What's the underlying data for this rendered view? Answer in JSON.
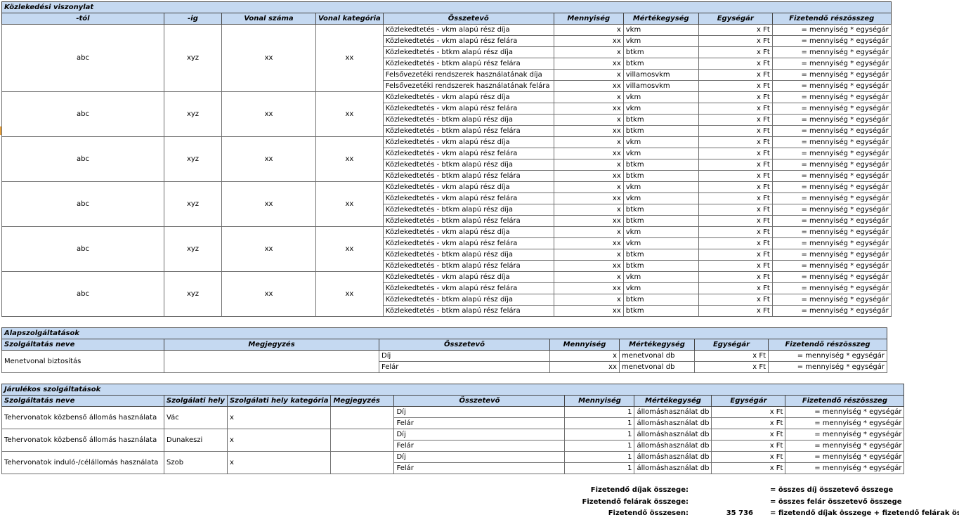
{
  "section1": {
    "title": "Közlekedési viszonylat",
    "headers": [
      "-tól",
      "-ig",
      "Vonal száma",
      "Vonal kategória",
      "Összetevő",
      "Mennyiség",
      "Mértékegység",
      "Egységár",
      "Fizetendő részösszeg"
    ],
    "groups": [
      {
        "from": "abc",
        "to": "xyz",
        "line": "xx",
        "category": "xx",
        "rows": [
          [
            "Közlekedtetés - vkm alapú rész díja",
            "x",
            "vkm",
            "x Ft",
            "= mennyiség * egységár"
          ],
          [
            "Közlekedtetés - vkm alapú rész felára",
            "xx",
            "vkm",
            "x Ft",
            "= mennyiség * egységár"
          ],
          [
            "Közlekedtetés - btkm alapú rész díja",
            "x",
            "btkm",
            "x Ft",
            "= mennyiség * egységár"
          ],
          [
            "Közlekedtetés - btkm alapú rész felára",
            "xx",
            "btkm",
            "x Ft",
            "= mennyiség * egységár"
          ],
          [
            "Felsővezetéki rendszerek használatának díja",
            "x",
            "villamosvkm",
            "x Ft",
            "= mennyiség * egységár"
          ],
          [
            "Felsővezetéki rendszerek használatának felára",
            "xx",
            "villamosvkm",
            "x Ft",
            "= mennyiség * egységár"
          ]
        ]
      },
      {
        "from": "abc",
        "to": "xyz",
        "line": "xx",
        "category": "xx",
        "rows": [
          [
            "Közlekedtetés - vkm alapú rész díja",
            "x",
            "vkm",
            "x Ft",
            "= mennyiség * egységár"
          ],
          [
            "Közlekedtetés - vkm alapú rész felára",
            "xx",
            "vkm",
            "x Ft",
            "= mennyiség * egységár"
          ],
          [
            "Közlekedtetés - btkm alapú rész díja",
            "x",
            "btkm",
            "x Ft",
            "= mennyiség * egységár"
          ],
          [
            "Közlekedtetés - btkm alapú rész felára",
            "xx",
            "btkm",
            "x Ft",
            "= mennyiség * egységár"
          ]
        ]
      },
      {
        "from": "abc",
        "to": "xyz",
        "line": "xx",
        "category": "xx",
        "rows": [
          [
            "Közlekedtetés - vkm alapú rész díja",
            "x",
            "vkm",
            "x Ft",
            "= mennyiség * egységár"
          ],
          [
            "Közlekedtetés - vkm alapú rész felára",
            "xx",
            "vkm",
            "x Ft",
            "= mennyiség * egységár"
          ],
          [
            "Közlekedtetés - btkm alapú rész díja",
            "x",
            "btkm",
            "x Ft",
            "= mennyiség * egységár"
          ],
          [
            "Közlekedtetés - btkm alapú rész felára",
            "xx",
            "btkm",
            "x Ft",
            "= mennyiség * egységár"
          ]
        ]
      },
      {
        "from": "abc",
        "to": "xyz",
        "line": "xx",
        "category": "xx",
        "rows": [
          [
            "Közlekedtetés - vkm alapú rész díja",
            "x",
            "vkm",
            "x Ft",
            "= mennyiség * egységár"
          ],
          [
            "Közlekedtetés - vkm alapú rész felára",
            "xx",
            "vkm",
            "x Ft",
            "= mennyiség * egységár"
          ],
          [
            "Közlekedtetés - btkm alapú rész díja",
            "x",
            "btkm",
            "x Ft",
            "= mennyiség * egységár"
          ],
          [
            "Közlekedtetés - btkm alapú rész felára",
            "xx",
            "btkm",
            "x Ft",
            "= mennyiség * egységár"
          ]
        ]
      },
      {
        "from": "abc",
        "to": "xyz",
        "line": "xx",
        "category": "xx",
        "rows": [
          [
            "Közlekedtetés - vkm alapú rész díja",
            "x",
            "vkm",
            "x Ft",
            "= mennyiség * egységár"
          ],
          [
            "Közlekedtetés - vkm alapú rész felára",
            "xx",
            "vkm",
            "x Ft",
            "= mennyiség * egységár"
          ],
          [
            "Közlekedtetés - btkm alapú rész díja",
            "x",
            "btkm",
            "x Ft",
            "= mennyiség * egységár"
          ],
          [
            "Közlekedtetés - btkm alapú rész felára",
            "xx",
            "btkm",
            "x Ft",
            "= mennyiség * egységár"
          ]
        ]
      },
      {
        "from": "abc",
        "to": "xyz",
        "line": "xx",
        "category": "xx",
        "rows": [
          [
            "Közlekedtetés - vkm alapú rész díja",
            "x",
            "vkm",
            "x Ft",
            "= mennyiség * egységár"
          ],
          [
            "Közlekedtetés - vkm alapú rész felára",
            "xx",
            "vkm",
            "x Ft",
            "= mennyiség * egységár"
          ],
          [
            "Közlekedtetés - btkm alapú rész díja",
            "x",
            "btkm",
            "x Ft",
            "= mennyiség * egységár"
          ],
          [
            "Közlekedtetés - btkm alapú rész felára",
            "xx",
            "btkm",
            "x Ft",
            "= mennyiség * egységár"
          ]
        ]
      }
    ]
  },
  "section2": {
    "title": "Alapszolgáltatások",
    "headers": [
      "Szolgáltatás neve",
      "Megjegyzés",
      "Összetevő",
      "Mennyiség",
      "Mértékegység",
      "Egységár",
      "Fizetendő részösszeg"
    ],
    "service": "Menetvonal biztosítás",
    "note": "",
    "rows": [
      [
        "Díj",
        "x",
        "menetvonal db",
        "x Ft",
        "= mennyiség * egységár"
      ],
      [
        "Felár",
        "xx",
        "menetvonal db",
        "x Ft",
        "= mennyiség * egységár"
      ]
    ]
  },
  "section3": {
    "title": "Járulékos szolgáltatások",
    "headers": [
      "Szolgáltatás neve",
      "Szolgálati hely",
      "Szolgálati hely kategória",
      "Megjegyzés",
      "Összetevő",
      "Mennyiség",
      "Mértékegység",
      "Egységár",
      "Fizetendő részösszeg"
    ],
    "groups": [
      {
        "name": "Tehervonatok közbenső állomás használata",
        "place": "Vác",
        "category": "x",
        "note": "",
        "rows": [
          [
            "Díj",
            "1",
            "állomáshasználat db",
            "x Ft",
            "= mennyiség * egységár"
          ],
          [
            "Felár",
            "1",
            "állomáshasználat db",
            "x Ft",
            "= mennyiség * egységár"
          ]
        ]
      },
      {
        "name": "Tehervonatok közbenső állomás használata",
        "place": "Dunakeszi",
        "category": "x",
        "note": "",
        "rows": [
          [
            "Díj",
            "1",
            "állomáshasználat db",
            "x Ft",
            "= mennyiség * egységár"
          ],
          [
            "Felár",
            "1",
            "állomáshasználat db",
            "x Ft",
            "= mennyiség * egységár"
          ]
        ]
      },
      {
        "name": "Tehervonatok induló-/célállomás használata",
        "place": "Szob",
        "category": "x",
        "note": "",
        "rows": [
          [
            "Díj",
            "1",
            "állomáshasználat db",
            "x Ft",
            "= mennyiség * egységár"
          ],
          [
            "Felár",
            "1",
            "állomáshasználat db",
            "x Ft",
            "= mennyiség * egységár"
          ]
        ]
      }
    ]
  },
  "summary": {
    "fees_label": "Fizetendő díjak összege:",
    "fees_desc": "= összes díj összetevő összege",
    "surcharges_label": "Fizetendő felárak összege:",
    "surcharges_desc": "= összes felár összetevő összege",
    "total_label": "Fizetendő összesen:",
    "total_value": "35 736",
    "total_desc": "= fizetendő díjak összege + fizetendő felárak összege"
  }
}
